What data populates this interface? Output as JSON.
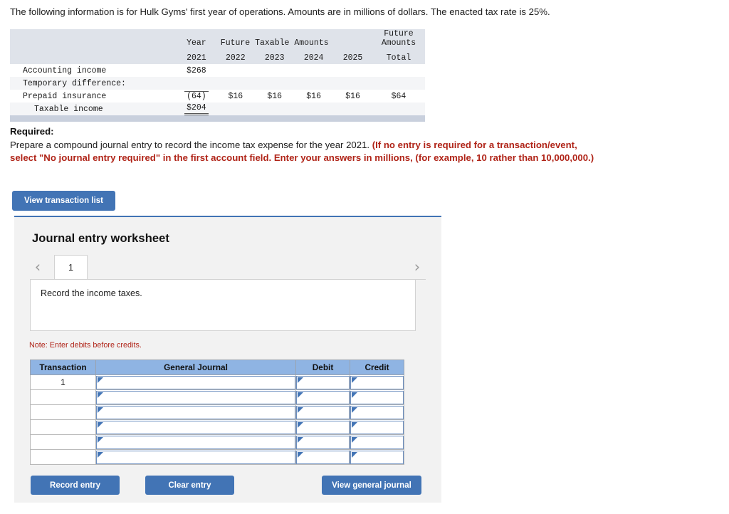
{
  "intro": {
    "text": "The following information is for Hulk Gyms' first year of operations. Amounts are in millions of dollars. The enacted tax rate is 25%."
  },
  "fact_table": {
    "header": {
      "year_label": "Year",
      "future_taxable_amounts": "Future Taxable Amounts",
      "future_amounts_total_line1": "Future",
      "future_amounts_total_line2": "Amounts",
      "future_amounts_total_line3": "Total",
      "years": [
        "2021",
        "2022",
        "2023",
        "2024",
        "2025"
      ]
    },
    "rows": [
      {
        "label": "Accounting income",
        "indent": false,
        "values": [
          "$268",
          "",
          "",
          "",
          "",
          ""
        ],
        "style": "plain"
      },
      {
        "label": "Temporary difference:",
        "indent": false,
        "values": [
          "",
          "",
          "",
          "",
          "",
          ""
        ],
        "style": "plain"
      },
      {
        "label": "Prepaid insurance",
        "indent": false,
        "values": [
          "(64)",
          "$16",
          "$16",
          "$16",
          "$16",
          "$64"
        ],
        "style": "underline-first"
      },
      {
        "label": "Taxable income",
        "indent": true,
        "values": [
          "$204",
          "",
          "",
          "",
          "",
          ""
        ],
        "style": "double-underline-first"
      }
    ]
  },
  "required": {
    "heading": "Required:",
    "body": "Prepare a compound journal entry to record the income tax expense for the year 2021. ",
    "warning": "(If no entry is required for a transaction/event, select \"No journal entry required\" in the first account field. Enter your answers in millions, (for example, 10 rather than 10,000,000.)"
  },
  "buttons": {
    "view_transaction_list": "View transaction list",
    "record_entry": "Record entry",
    "clear_entry": "Clear entry",
    "view_general_journal": "View general journal"
  },
  "worksheet": {
    "title": "Journal entry worksheet",
    "prev_icon": "‹",
    "next_icon": "›",
    "tabs": [
      "1"
    ],
    "active_tab": "1",
    "description": "Record the income taxes.",
    "note": "Note: Enter debits before credits."
  },
  "journal_table": {
    "columns": [
      "Transaction",
      "General Journal",
      "Debit",
      "Credit"
    ],
    "rows": [
      {
        "transaction": "1",
        "general_journal": "",
        "debit": "",
        "credit": ""
      },
      {
        "transaction": "",
        "general_journal": "",
        "debit": "",
        "credit": ""
      },
      {
        "transaction": "",
        "general_journal": "",
        "debit": "",
        "credit": ""
      },
      {
        "transaction": "",
        "general_journal": "",
        "debit": "",
        "credit": ""
      },
      {
        "transaction": "",
        "general_journal": "",
        "debit": "",
        "credit": ""
      },
      {
        "transaction": "",
        "general_journal": "",
        "debit": "",
        "credit": ""
      }
    ]
  },
  "colors": {
    "accent_blue": "#4274b5",
    "table_header_blue": "#8fb4e3",
    "warning_red": "#b02418",
    "panel_bg": "#f2f2f2",
    "fact_header_bg": "#dfe3ea"
  }
}
